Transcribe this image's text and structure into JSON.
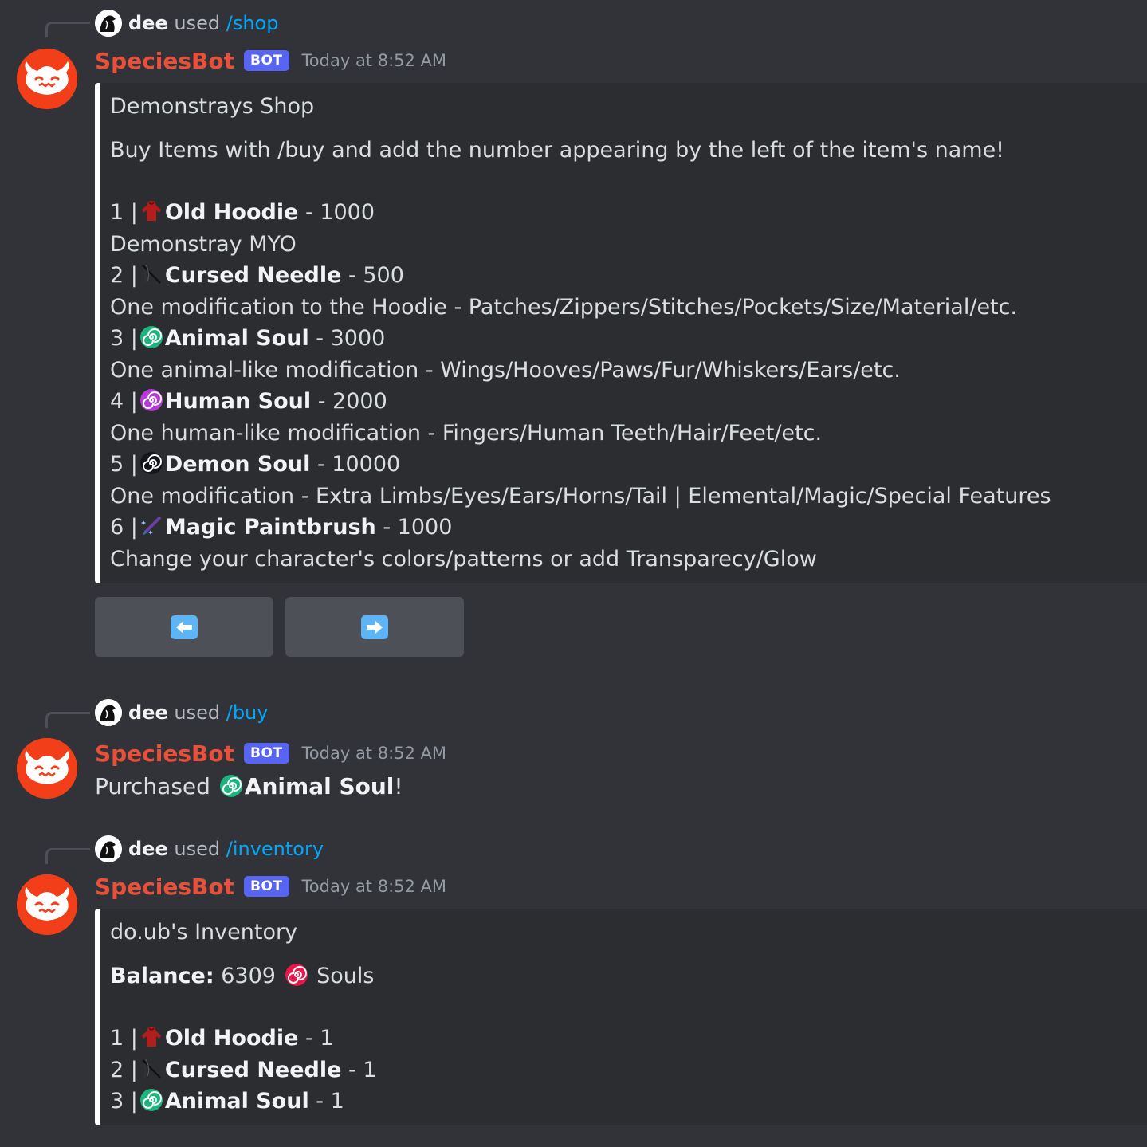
{
  "messages": [
    {
      "reply": {
        "user": "dee",
        "used": "used",
        "command": "/shop"
      },
      "author": "SpeciesBot",
      "bot_tag": "BOT",
      "timestamp": "Today at 8:52 AM",
      "embed": {
        "title": "Demonstrays Shop",
        "description": "Buy Items with /buy and add the number appearing by the left of the item's name!",
        "items": [
          {
            "num": "1 |",
            "icon": "hoodie-icon",
            "name": "Old Hoodie",
            "suffix": " - 1000",
            "desc": "Demonstray MYO"
          },
          {
            "num": "2 |",
            "icon": "needle-icon",
            "name": "Cursed Needle",
            "suffix": " - 500",
            "desc": "One modification to the Hoodie - Patches/Zippers/Stitches/Pockets/Size/Material/etc."
          },
          {
            "num": "3 |",
            "icon": "animal-soul-icon",
            "name": "Animal Soul",
            "suffix": " - 3000",
            "desc": "One animal-like modification - Wings/Hooves/Paws/Fur/Whiskers/Ears/etc."
          },
          {
            "num": "4 |",
            "icon": "human-soul-icon",
            "name": "Human Soul",
            "suffix": " - 2000",
            "desc": "One human-like modification - Fingers/Human Teeth/Hair/Feet/etc."
          },
          {
            "num": "5 |",
            "icon": "demon-soul-icon",
            "name": "Demon Soul",
            "suffix": " - 10000",
            "desc": "One modification - Extra Limbs/Eyes/Ears/Horns/Tail | Elemental/Magic/Special Features"
          },
          {
            "num": "6 |",
            "icon": "paintbrush-icon",
            "name": "Magic Paintbrush",
            "suffix": " - 1000",
            "desc": "Change your character's colors/patterns or add Transparecy/Glow"
          }
        ]
      },
      "buttons": [
        {
          "icon": "arrow-left-icon",
          "arrow": "⬅"
        },
        {
          "icon": "arrow-right-icon",
          "arrow": "➡"
        }
      ]
    },
    {
      "reply": {
        "user": "dee",
        "used": "used",
        "command": "/buy"
      },
      "author": "SpeciesBot",
      "bot_tag": "BOT",
      "timestamp": "Today at 8:52 AM",
      "content": {
        "prefix": "Purchased ",
        "item": "Animal Soul",
        "suffix": "!"
      }
    },
    {
      "reply": {
        "user": "dee",
        "used": "used",
        "command": "/inventory"
      },
      "author": "SpeciesBot",
      "bot_tag": "BOT",
      "timestamp": "Today at 8:52 AM",
      "embed": {
        "title": "do.ub's Inventory",
        "balance_label": "Balance:",
        "balance_value": " 6309 ",
        "balance_unit": " Souls",
        "items": [
          {
            "num": "1 |",
            "icon": "hoodie-icon",
            "name": "Old Hoodie",
            "suffix": " - 1"
          },
          {
            "num": "2 |",
            "icon": "needle-icon",
            "name": "Cursed Needle",
            "suffix": " - 1"
          },
          {
            "num": "3 |",
            "icon": "animal-soul-icon",
            "name": "Animal Soul",
            "suffix": " - 1"
          }
        ]
      }
    }
  ],
  "colors": {
    "background": "#313338",
    "embed_bg": "#2b2d31",
    "bot_name": "#e9503a",
    "bot_tag": "#5865f2",
    "command_link": "#00a8fc",
    "avatar": "#f23f1a"
  }
}
